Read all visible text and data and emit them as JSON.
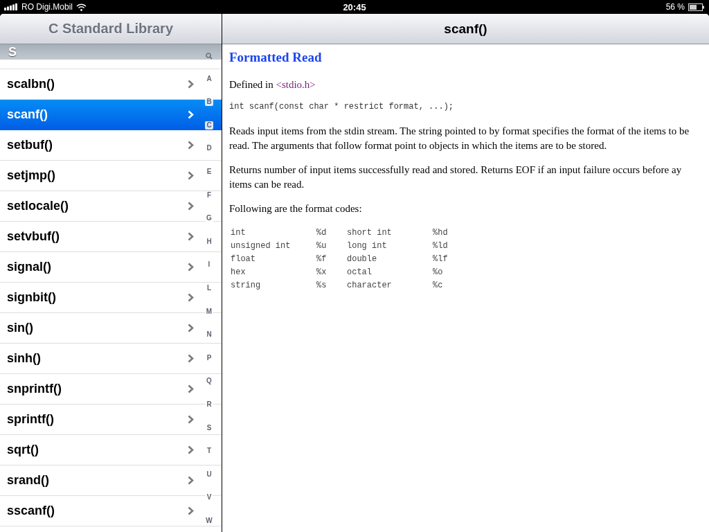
{
  "status_bar": {
    "carrier": "RO Digi.Mobil",
    "time": "20:45",
    "battery": "56 %"
  },
  "sidebar": {
    "title": "C Standard Library",
    "section": "S",
    "items": [
      {
        "label": "scalbn()",
        "selected": false
      },
      {
        "label": "scanf()",
        "selected": true
      },
      {
        "label": "setbuf()",
        "selected": false
      },
      {
        "label": "setjmp()",
        "selected": false
      },
      {
        "label": "setlocale()",
        "selected": false
      },
      {
        "label": "setvbuf()",
        "selected": false
      },
      {
        "label": "signal()",
        "selected": false
      },
      {
        "label": "signbit()",
        "selected": false
      },
      {
        "label": "sin()",
        "selected": false
      },
      {
        "label": "sinh()",
        "selected": false
      },
      {
        "label": "snprintf()",
        "selected": false
      },
      {
        "label": "sprintf()",
        "selected": false
      },
      {
        "label": "sqrt()",
        "selected": false
      },
      {
        "label": "srand()",
        "selected": false
      },
      {
        "label": "sscanf()",
        "selected": false
      }
    ],
    "index": [
      "A",
      "B",
      "C",
      "D",
      "E",
      "F",
      "G",
      "H",
      "I",
      "L",
      "M",
      "N",
      "P",
      "Q",
      "R",
      "S",
      "T",
      "U",
      "V",
      "W"
    ]
  },
  "detail": {
    "title": "scanf()",
    "heading": "Formatted Read",
    "defined_in": "Defined in",
    "header_link": "<stdio.h>",
    "signature": "int scanf(const char * restrict format, ...);",
    "paragraphs": [
      "Reads input items from the stdin stream. The string pointed to by format specifies the format of the items to be read. The arguments that follow format point to objects in which the items are to be stored.",
      "Returns number of input items successfully read and stored. Returns EOF if an input failure occurs before ay items can be read.",
      "Following are the format codes:"
    ],
    "format_codes": [
      [
        "int",
        "%d",
        "short int",
        "%hd"
      ],
      [
        "unsigned int",
        "%u",
        "long int",
        "%ld"
      ],
      [
        "float",
        "%f",
        "double",
        "%lf"
      ],
      [
        "hex",
        "%x",
        "octal",
        "%o"
      ],
      [
        "string",
        "%s",
        "character",
        "%c"
      ]
    ]
  }
}
